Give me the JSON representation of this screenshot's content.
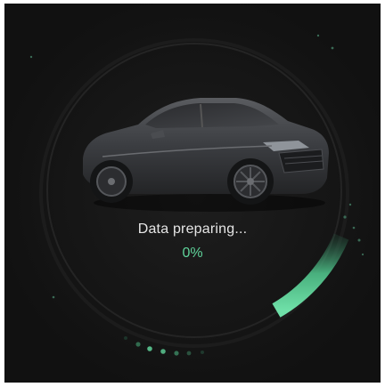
{
  "loader": {
    "status_label": "Data preparing...",
    "progress_text": "0%",
    "progress_fraction": 0.0
  },
  "illustration": {
    "icon": "sedan-car-icon"
  },
  "colors": {
    "background": "#121212",
    "accent": "#5fd39a",
    "text": "#e6e6e6"
  }
}
